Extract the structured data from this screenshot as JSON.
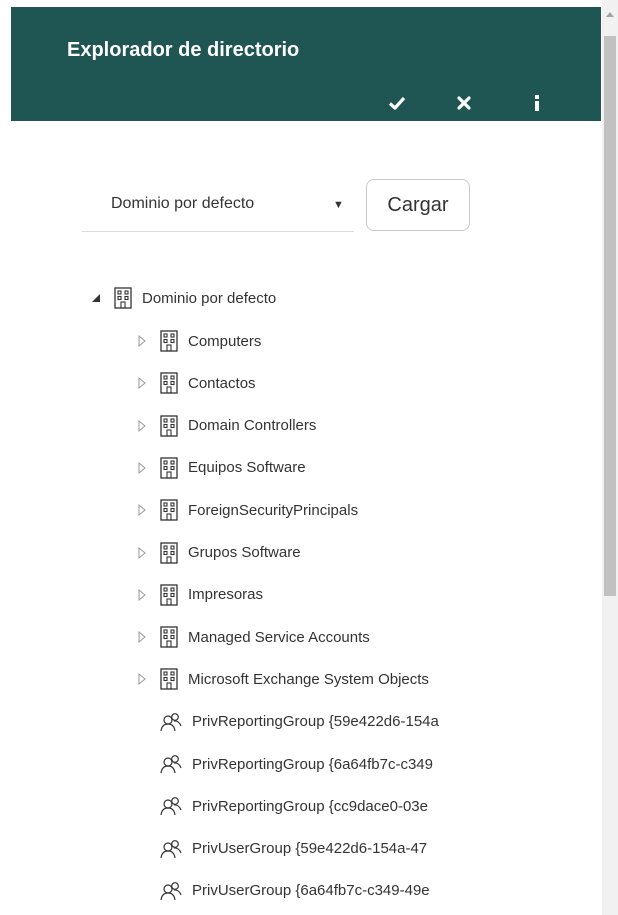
{
  "header": {
    "title": "Explorador de directorio",
    "buttons": [
      {
        "icon": "check-icon"
      },
      {
        "icon": "close-icon"
      },
      {
        "icon": "info-icon"
      }
    ],
    "color": "#1f5654"
  },
  "domain_selector": {
    "value": "Dominio por defecto",
    "load_label": "Cargar"
  },
  "tree": {
    "root": {
      "label": "Dominio por defecto",
      "icon": "building-icon",
      "expanded": true
    },
    "children": [
      {
        "label": "Computers",
        "icon": "building-icon",
        "expandable": true
      },
      {
        "label": "Contactos",
        "icon": "building-icon",
        "expandable": true
      },
      {
        "label": "Domain Controllers",
        "icon": "building-icon",
        "expandable": true
      },
      {
        "label": "Equipos Software",
        "icon": "building-icon",
        "expandable": true
      },
      {
        "label": "ForeignSecurityPrincipals",
        "icon": "building-icon",
        "expandable": true
      },
      {
        "label": "Grupos Software",
        "icon": "building-icon",
        "expandable": true
      },
      {
        "label": "Impresoras",
        "icon": "building-icon",
        "expandable": true
      },
      {
        "label": "Managed Service Accounts",
        "icon": "building-icon",
        "expandable": true
      },
      {
        "label": "Microsoft Exchange System Objects",
        "icon": "building-icon",
        "expandable": true
      },
      {
        "label": "PrivReportingGroup {59e422d6-154a",
        "icon": "group-icon",
        "expandable": false
      },
      {
        "label": "PrivReportingGroup {6a64fb7c-c349",
        "icon": "group-icon",
        "expandable": false
      },
      {
        "label": "PrivReportingGroup {cc9dace0-03e",
        "icon": "group-icon",
        "expandable": false
      },
      {
        "label": "PrivUserGroup {59e422d6-154a-47",
        "icon": "group-icon",
        "expandable": false
      },
      {
        "label": "PrivUserGroup {6a64fb7c-c349-49e",
        "icon": "group-icon",
        "expandable": false
      }
    ]
  }
}
